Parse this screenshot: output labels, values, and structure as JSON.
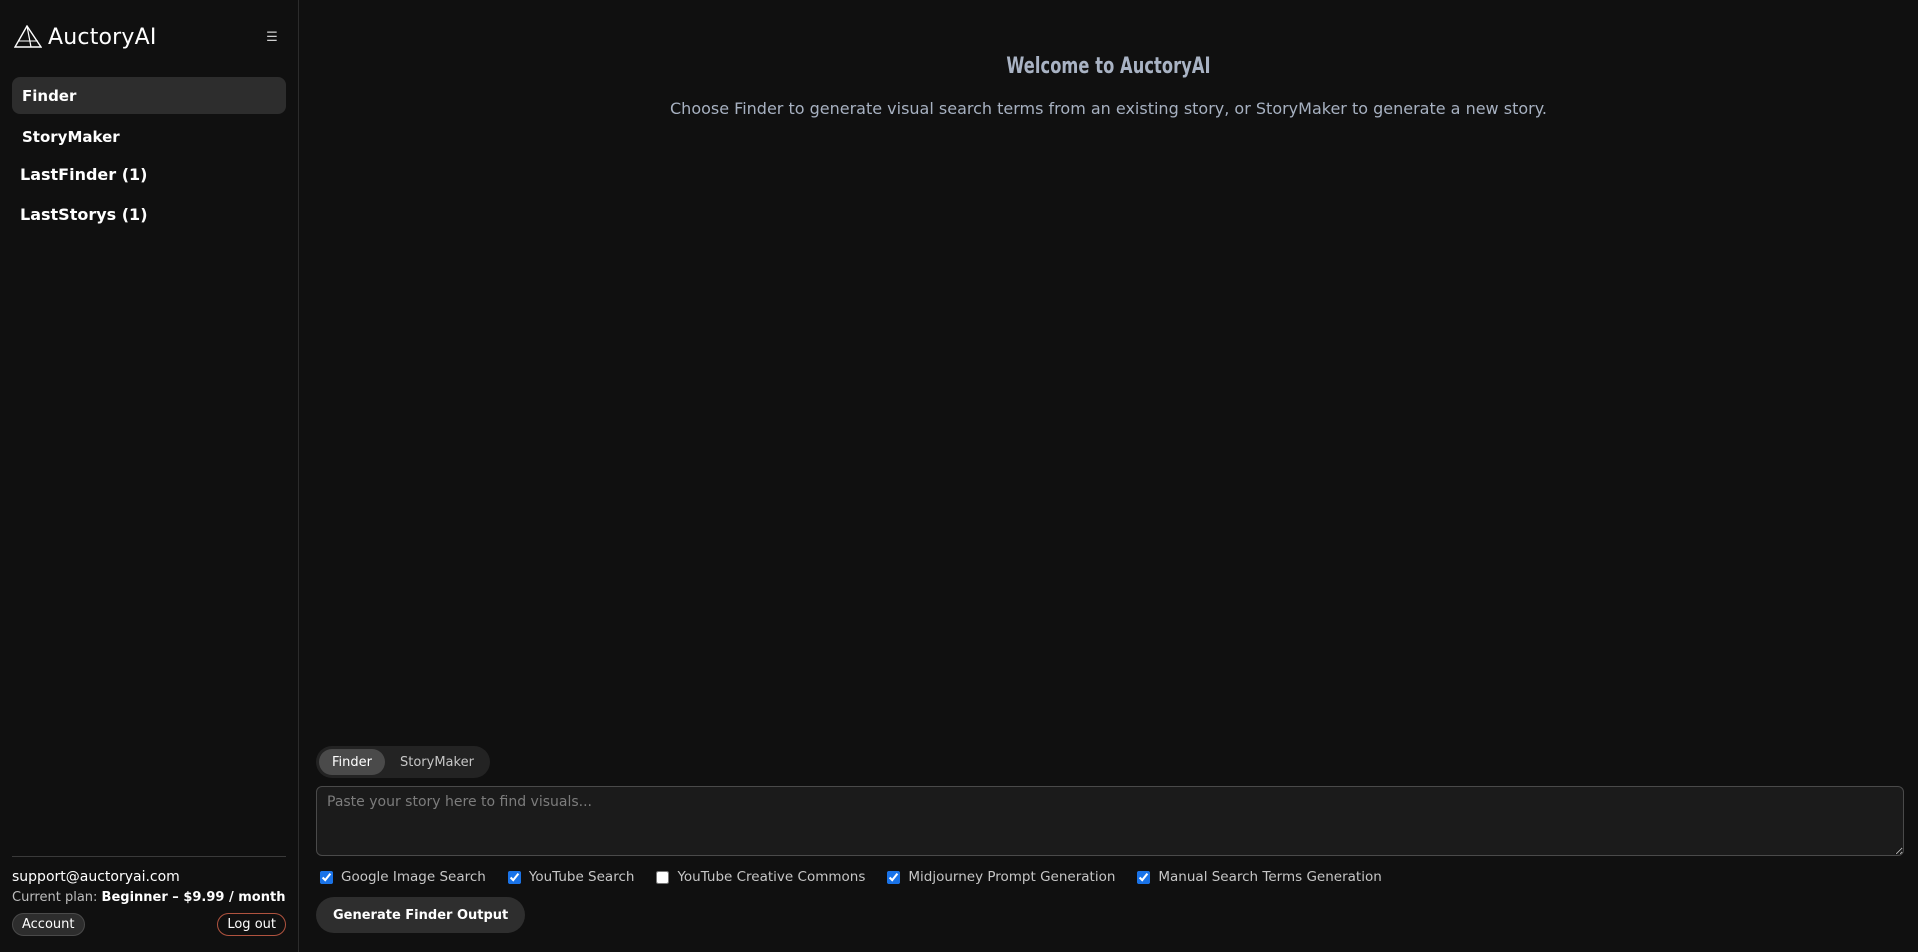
{
  "brand": {
    "name": "AuctoryAI",
    "logo_icon": "pyramid-logo-icon",
    "menu_icon": "☰"
  },
  "sidebar": {
    "nav": [
      {
        "label": "Finder",
        "active": true
      },
      {
        "label": "StoryMaker",
        "active": false
      }
    ],
    "history": [
      {
        "label": "LastFinder (1)"
      },
      {
        "label": "LastStorys (1)"
      }
    ],
    "footer": {
      "email": "support@auctoryai.com",
      "plan_prefix": "Current plan: ",
      "plan_name": "Beginner – $9.99 / month",
      "account_label": "Account",
      "logout_label": "Log out"
    }
  },
  "main": {
    "title": "Welcome to AuctoryAI",
    "subtitle": "Choose Finder to generate visual search terms from an existing story, or StoryMaker to generate a new story.",
    "modes": [
      "Finder",
      "StoryMaker"
    ],
    "active_mode": "Finder",
    "input": {
      "value": "",
      "placeholder": "Paste your story here to find visuals..."
    },
    "options": [
      {
        "label": "Google Image Search",
        "checked": true
      },
      {
        "label": "YouTube Search",
        "checked": true
      },
      {
        "label": "YouTube Creative Commons",
        "checked": false
      },
      {
        "label": "Midjourney Prompt Generation",
        "checked": true
      },
      {
        "label": "Manual Search Terms Generation",
        "checked": true
      }
    ],
    "generate_label": "Generate Finder Output"
  },
  "colors": {
    "background": "#101010",
    "sidebar_active": "#2d2d2d",
    "title_text": "#a9b3c4",
    "logout_border": "#b0533f",
    "checkbox_accent": "#1a73e8"
  }
}
